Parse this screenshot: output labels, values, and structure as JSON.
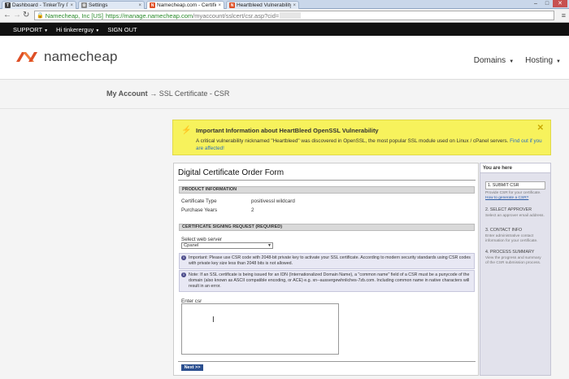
{
  "browser": {
    "tabs": [
      {
        "label": "Dashboard - TinkerTry IT",
        "favicon_color": "#444444",
        "active": false
      },
      {
        "label": "Settings",
        "favicon_color": "#888888",
        "active": false
      },
      {
        "label": "Namecheap.com - Certific",
        "favicon_color": "#de4f26",
        "active": true
      },
      {
        "label": "Heartbleed Vulnerability",
        "favicon_color": "#de4f26",
        "active": false
      }
    ],
    "url": {
      "ev_label": "Namecheap, Inc [US]",
      "scheme_host": "https://manage.namecheap.com",
      "path": "/myaccount/sslcert/csr.asp?cid="
    }
  },
  "topbar": {
    "support": "SUPPORT",
    "greeting": "Hi tinkererguy",
    "signout": "SIGN OUT"
  },
  "header": {
    "logo_text": "namecheap",
    "nav": [
      {
        "label": "Domains"
      },
      {
        "label": "Hosting"
      }
    ]
  },
  "breadcrumb": {
    "root": "My Account",
    "separator": "→",
    "current": "SSL Certificate - CSR"
  },
  "notice": {
    "title": "Important Information about HeartBleed OpenSSL Vulnerability",
    "body": "A critical vulnerability nicknamed \"Heartbleed\" was discovered in OpenSSL, the most popular SSL module used on Linux / cPanel servers.",
    "link": "Find out if you are affected!"
  },
  "form": {
    "title": "Digital Certificate Order Form",
    "product_header": "PRODUCT INFORMATION",
    "cert_type_label": "Certificate Type",
    "cert_type_value": "positivessl wildcard",
    "years_label": "Purchase Years",
    "years_value": "2",
    "csr_header": "CERTIFICATE SIGNING REQUEST (REQUIRED)",
    "server_label": "Select web server",
    "server_value": "Cpanel",
    "important_note": "Important: Please use CSR code with 2048-bit private key to activate your SSL certificate. According to modern security standards using CSR codes with private key size less than 2048 bits is not allowed.",
    "idn_note": "Note: If an SSL certificate is being issued for an IDN (Internationalized Domain Name), a \"common name\" field of a CSR must be a punycode of the domain (also known as ASCII compatible encoding, or ACE) e.g. xn--aussergewhnliches-7zb.com. Including common name in native characters will result in an error.",
    "csr_label": "Enter csr",
    "next_label": "Next >>"
  },
  "sidebar": {
    "header": "You are here",
    "steps": [
      {
        "title": "1. SUBMIT CSR",
        "desc": "Provide CSR for your certificate.",
        "link": "How to generate a CSR?",
        "active": true
      },
      {
        "title": "2. SELECT APPROVER",
        "desc": "Select an approver email address.",
        "active": false
      },
      {
        "title": "3. CONTACT INFO",
        "desc": "Enter administrative contact information for your certificate.",
        "active": false
      },
      {
        "title": "4. PROCESS SUMMARY",
        "desc": "View the progress and summary of the CSR submission process.",
        "active": false
      }
    ]
  },
  "colors": {
    "brand_orange": "#de4f26",
    "notice_yellow": "#f7f25c",
    "button_blue": "#2b4f8f"
  }
}
